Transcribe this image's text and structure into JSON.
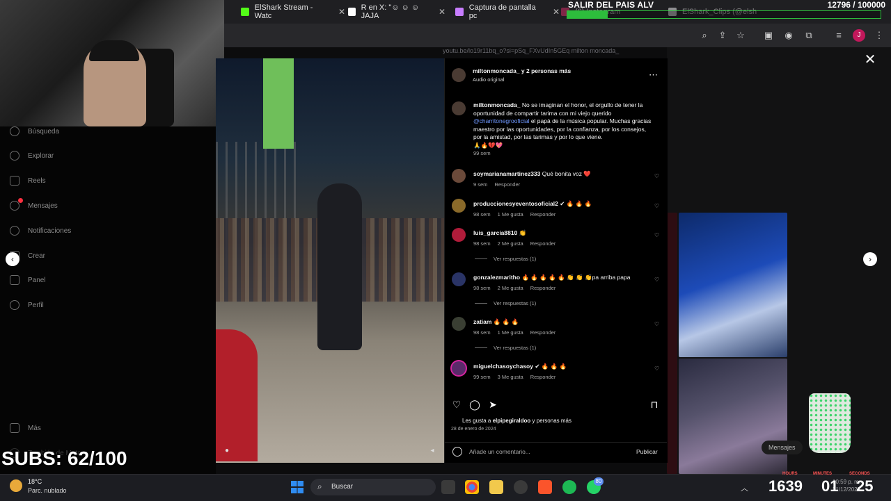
{
  "browser": {
    "tabs": [
      {
        "label": "ElShark Stream - Watc",
        "icon": "kick-icon",
        "color": "#53fc18"
      },
      {
        "label": "R en X: \"☺ ☺ ☺ JAJA",
        "icon": "x-icon",
        "color": "#ffffff"
      },
      {
        "label": "Captura de pantalla pc",
        "icon": "feather-icon",
        "color": "#c77dff"
      },
      {
        "label": "(6) Instagram",
        "icon": "instagram-icon",
        "color": "#e1306c"
      },
      {
        "label": "ElShark_Clips (@elsh",
        "icon": "tiktok-icon",
        "color": "#ffffff"
      }
    ],
    "url_hint": "youtu.be/lo19r11bq_o?si=pSq_FXvUdIn5GEq   milton moncada_"
  },
  "overlay": {
    "banner_title": "SALIR DEL PAIS ALV",
    "banner_count": "12796 / 100000",
    "progress": 0.128,
    "subs": "SUBS: 62/100"
  },
  "sidebar": {
    "items": [
      {
        "label": "Búsqueda",
        "icon": "search-icon"
      },
      {
        "label": "Explorar",
        "icon": "compass-icon"
      },
      {
        "label": "Reels",
        "icon": "reels-icon"
      },
      {
        "label": "Mensajes",
        "icon": "messenger-icon"
      },
      {
        "label": "Notificaciones",
        "icon": "heart-icon"
      },
      {
        "label": "Crear",
        "icon": "plus-icon"
      },
      {
        "label": "Panel",
        "icon": "chart-icon"
      },
      {
        "label": "Perfil",
        "icon": "profile-icon"
      }
    ],
    "more": "Más",
    "also_meta": "También de Meta"
  },
  "post": {
    "author": "miltonmoncada_ y 2 personas más",
    "audio": "Audio original",
    "caption_user": "miltonmoncada_",
    "caption_part1": "No se imaginan el honor, el orgullo de tener la oportunidad de compartir tarima con mi viejo querido",
    "caption_link": "@charritonegrooficial",
    "caption_part2": "el papá de la música popular. Muchas gracias maestro por las oportunidades, por la confianza, por los consejos, por la amistad, por las tarimas y por lo que viene.",
    "caption_emojis": "🙏🔥💔💖",
    "caption_time": "99 sem",
    "likes_prefix": "Les gusta a",
    "likes_user": "elpipegiraldoo",
    "likes_suffix": "y personas más",
    "date": "28 de enero de 2024",
    "add_comment_placeholder": "Añade un comentario...",
    "publish": "Publicar"
  },
  "comments": [
    {
      "user": "soymarianamartinez333",
      "text": "Qué bonita voz ❤️",
      "time": "9 sem",
      "likes": "",
      "reply": "Responder",
      "replies": ""
    },
    {
      "user": "produccionesyeventosoficial2",
      "text": "✔ 🔥 🔥 🔥",
      "time": "98 sem",
      "likes": "1 Me gusta",
      "reply": "Responder",
      "replies": ""
    },
    {
      "user": "luis_garcia8810",
      "text": "👏",
      "time": "98 sem",
      "likes": "2 Me gusta",
      "reply": "Responder",
      "replies": "Ver respuestas (1)"
    },
    {
      "user": "gonzalezmaritho",
      "text": "🔥 🔥 🔥 🔥 🔥 👏 👏 👏pa arriba papa",
      "time": "98 sem",
      "likes": "2 Me gusta",
      "reply": "Responder",
      "replies": "Ver respuestas (1)"
    },
    {
      "user": "zatiam",
      "text": "🔥 🔥 🔥",
      "time": "98 sem",
      "likes": "1 Me gusta",
      "reply": "Responder",
      "replies": "Ver respuestas (1)"
    },
    {
      "user": "miguelchasoychasoy",
      "text": "✔ 🔥 🔥 🔥",
      "time": "99 sem",
      "likes": "3 Me gusta",
      "reply": "Responder",
      "replies": ""
    }
  ],
  "taskbar": {
    "temp": "18°C",
    "weather": "Parc. nublado",
    "search": "Buscar",
    "time": "10:59 p. m.",
    "date": "21/12/2025",
    "whatsapp_badge": "80"
  },
  "timer": {
    "hours_label": "HOURS",
    "hours": "1639",
    "minutes_label": "MINUTES",
    "minutes": "01",
    "seconds_label": "SECONDS",
    "seconds": "25"
  },
  "chip": {
    "label": "Mensajes"
  }
}
